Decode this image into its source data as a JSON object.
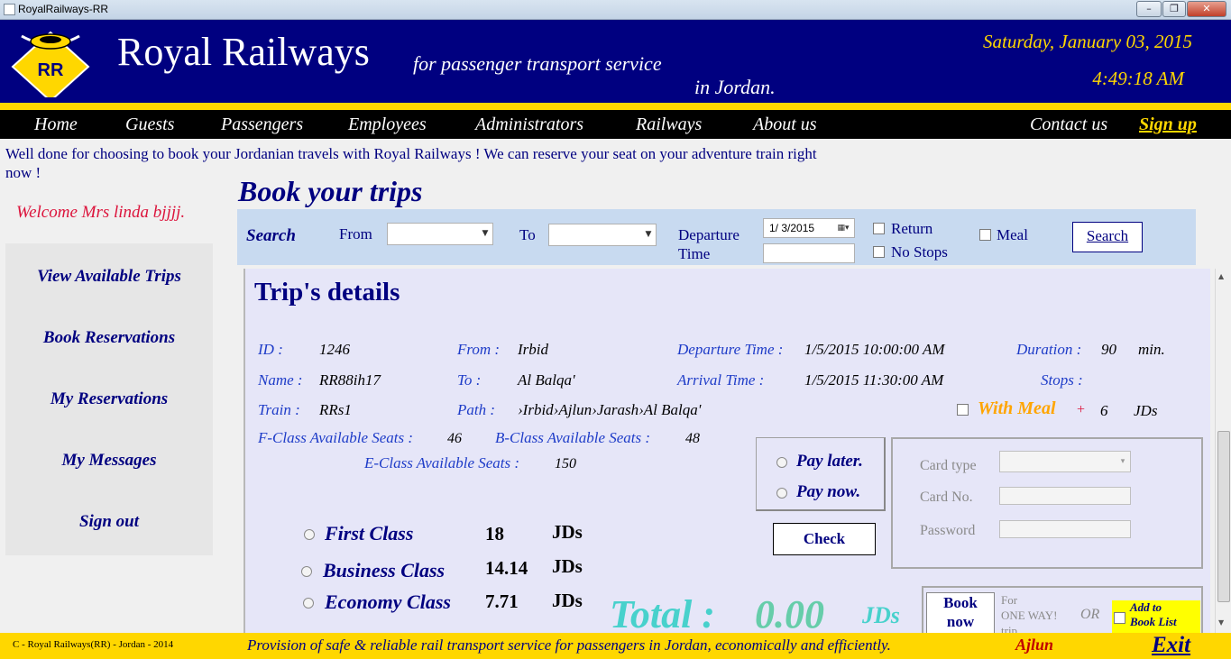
{
  "window": {
    "title": "RoyalRailways-RR",
    "minimize": "–",
    "restore": "❐",
    "close": "✕"
  },
  "header": {
    "logo_text": "RR",
    "brand": "Royal Railways",
    "tagline_line1": "for passenger transport service",
    "tagline_line2": "in Jordan.",
    "date": "Saturday, January 03, 2015",
    "time": "4:49:18 AM",
    "colors": {
      "background": "#000080",
      "accent": "#ffd700"
    }
  },
  "nav": {
    "items": [
      "Home",
      "Guests",
      "Passengers",
      "Employees",
      "Administrators",
      "Railways",
      "About us"
    ],
    "contact": "Contact us",
    "signup": "Sign up"
  },
  "intro": "Well done for choosing to book your Jordanian travels with Royal Railways !   We can reserve your seat on your adventure train right now !",
  "welcome": "Welcome Mrs linda bjjjj.",
  "sidebar": {
    "items": [
      "View Available Trips",
      "Book Reservations",
      "My Reservations",
      "My Messages",
      "Sign out"
    ]
  },
  "book": {
    "title": "Book your trips",
    "search_label": "Search",
    "from_label": "From",
    "to_label": "To",
    "departure_label_1": "Departure",
    "departure_label_2": "Time",
    "date_value": "1/  3/2015",
    "return_label": "Return",
    "nostops_label": "No Stops",
    "meal_label": "Meal",
    "search_button": "Search"
  },
  "trip": {
    "heading": "Trip's details",
    "id_label": "ID :",
    "id": "1246",
    "name_label": "Name :",
    "name": "RR88ih17",
    "train_label": "Train :",
    "train": "RRs1",
    "from_label": "From :",
    "from": "Irbid",
    "to_label": "To :",
    "to": "Al Balqa'",
    "path_label": "Path :",
    "path": "›Irbid›Ajlun›Jarash›Al Balqa'",
    "dep_label": "Departure Time :",
    "dep": "1/5/2015 10:00:00 AM",
    "arr_label": "Arrival Time :",
    "arr": "1/5/2015 11:30:00 AM",
    "dur_label": "Duration :",
    "dur": "90",
    "dur_unit": "min.",
    "stops_label": "Stops :",
    "meal_label": "With Meal",
    "meal_plus": "+",
    "meal_price": "6",
    "meal_currency": "JDs",
    "fclass_label": "F-Class Available Seats :",
    "fclass": "46",
    "bclass_label": "B-Class Available Seats :",
    "bclass": "48",
    "eclass_label": "E-Class Available Seats :",
    "eclass": "150"
  },
  "classes": [
    {
      "name": "First Class",
      "price": "18",
      "currency": "JDs"
    },
    {
      "name": "Business Class",
      "price": "14.14",
      "currency": "JDs"
    },
    {
      "name": "Economy Class",
      "price": "7.71",
      "currency": "JDs"
    }
  ],
  "payment": {
    "pay_later": "Pay later.",
    "pay_now": "Pay now.",
    "check_button": "Check",
    "card_type_label": "Card type",
    "card_no_label": "Card No.",
    "password_label": "Password"
  },
  "total": {
    "label": "Total :",
    "value": "0.00",
    "currency": "JDs"
  },
  "booking": {
    "book_now_1": "Book",
    "book_now_2": "now",
    "for_label": "For",
    "one_way": "ONE WAY!",
    "or_label": "OR",
    "trip_label": "trip",
    "add_label_1": "Add to",
    "add_label_2": "Book List"
  },
  "footer": {
    "copyright": "C - Royal Railways(RR) - Jordan - 2014",
    "motto": "Provision of safe & reliable rail transport service for passengers in Jordan, economically and efficiently.",
    "city": "Ajlun",
    "exit": "Exit"
  }
}
